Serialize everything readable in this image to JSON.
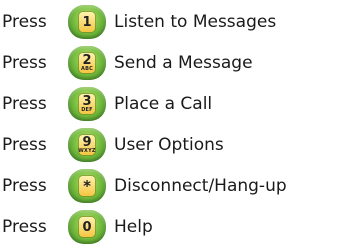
{
  "accent_green": "#7cc142",
  "keycap_yellow": "#f4c542",
  "items": [
    {
      "press": "Press",
      "key": "1",
      "letters": "",
      "label": "Listen to Messages"
    },
    {
      "press": "Press",
      "key": "2",
      "letters": "ABC",
      "label": "Send a Message"
    },
    {
      "press": "Press",
      "key": "3",
      "letters": "DEF",
      "label": "Place a Call"
    },
    {
      "press": "Press",
      "key": "9",
      "letters": "WXYZ",
      "label": "User Options"
    },
    {
      "press": "Press",
      "key": "*",
      "letters": "",
      "label": "Disconnect/Hang-up"
    },
    {
      "press": "Press",
      "key": "0",
      "letters": "",
      "label": "Help"
    }
  ]
}
